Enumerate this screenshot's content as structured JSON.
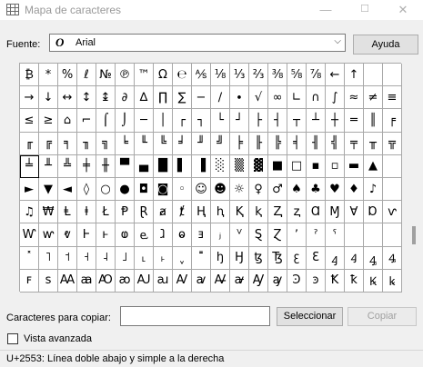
{
  "window": {
    "title": "Mapa de caracteres",
    "min_glyph": "—",
    "max_glyph": "☐",
    "close_glyph": "✕"
  },
  "font": {
    "label": "Fuente:",
    "type_glyph": "O",
    "selected": "Arial",
    "dropdown_glyph": "⌵"
  },
  "help_button": "Ayuda",
  "character_grid": {
    "rows": [
      [
        "₿",
        "*",
        "%",
        "ℓ",
        "№",
        "℗",
        "™",
        "Ω",
        "℮",
        "⅍",
        "⅛",
        "⅓",
        "⅔",
        "⅜",
        "⅝",
        "⅞",
        "←",
        "↑",
        "",
        ""
      ],
      [
        "→",
        "↓",
        "↔",
        "↕",
        "↨",
        "∂",
        "∆",
        "∏",
        "∑",
        "−",
        "∕",
        "∙",
        "√",
        "∞",
        "∟",
        "∩",
        "∫",
        "≈",
        "≠",
        "≡"
      ],
      [
        "≤",
        "≥",
        "⌂",
        "⌐",
        "⌠",
        "⌡",
        "─",
        "│",
        "┌",
        "┐",
        "└",
        "┘",
        "├",
        "┤",
        "┬",
        "┴",
        "┼",
        "═",
        "║",
        "╒"
      ],
      [
        "╓",
        "╔",
        "╕",
        "╖",
        "╗",
        "╘",
        "╙",
        "╚",
        "╛",
        "╜",
        "╝",
        "╞",
        "╟",
        "╠",
        "╡",
        "╢",
        "╣",
        "╤",
        "╥",
        "╦"
      ],
      [
        "╧",
        "╨",
        "╩",
        "╪",
        "╫",
        "▀",
        "▄",
        "█",
        "▌",
        "▐",
        "░",
        "▒",
        "▓",
        "■",
        "□",
        "▪",
        "▫",
        "▬",
        "▲",
        ""
      ],
      [
        "►",
        "▼",
        "◄",
        "◊",
        "○",
        "●",
        "◘",
        "◙",
        "◦",
        "☺",
        "☻",
        "☼",
        "♀",
        "♂",
        "♠",
        "♣",
        "♥",
        "♦",
        "♪",
        ""
      ],
      [
        "♫",
        "₩",
        "Ⱡ",
        "ⱡ",
        "Ł",
        "Ᵽ",
        "Ɽ",
        "ⱥ",
        "ⱦ",
        "Ⱨ",
        "ⱨ",
        "Ⱪ",
        "ⱪ",
        "Ⱬ",
        "ⱬ",
        "Ɑ",
        "Ɱ",
        "Ɐ",
        "Ɒ",
        "ⱱ"
      ],
      [
        "Ⱳ",
        "ⱳ",
        "ⱴ",
        "Ⱶ",
        "ⱶ",
        "ⱷ",
        "ⱸ",
        "ⱹ",
        "ⱺ",
        "ⱻ",
        "ⱼ",
        "ⱽ",
        "Ȿ",
        "Ɀ",
        "ʼ",
        "ˀ",
        "ˁ",
        "",
        "",
        ""
      ],
      [
        "˟",
        "˥",
        "˦",
        "˧",
        "˨",
        "˩",
        "˪",
        "˫",
        "ˬ",
        "˭",
        "ꜧ",
        "Ꜧ",
        "ꜩ",
        "Ꜩ",
        "ꜫ",
        "Ꜫ",
        "ꜭ",
        "Ꜭ",
        "ꜯ",
        "Ꜯ"
      ],
      [
        "ꜰ",
        "ꜱ",
        "Ꜳ",
        "ꜳ",
        "Ꜵ",
        "ꜵ",
        "Ꜷ",
        "ꜷ",
        "Ꜹ",
        "ꜹ",
        "Ꜻ",
        "ꜻ",
        "Ꜽ",
        "ꜽ",
        "Ꜿ",
        "ꜿ",
        "Ꝁ",
        "ꝁ",
        "Ꝃ",
        "ꝃ"
      ]
    ]
  },
  "copy": {
    "label": "Caracteres para copiar:",
    "value": "",
    "select_button": "Seleccionar",
    "copy_button": "Copiar"
  },
  "advanced_view": {
    "label": "Vista avanzada",
    "checked": false
  },
  "status_bar": {
    "text": "U+2553: Línea doble abajo y simple a la derecha"
  }
}
